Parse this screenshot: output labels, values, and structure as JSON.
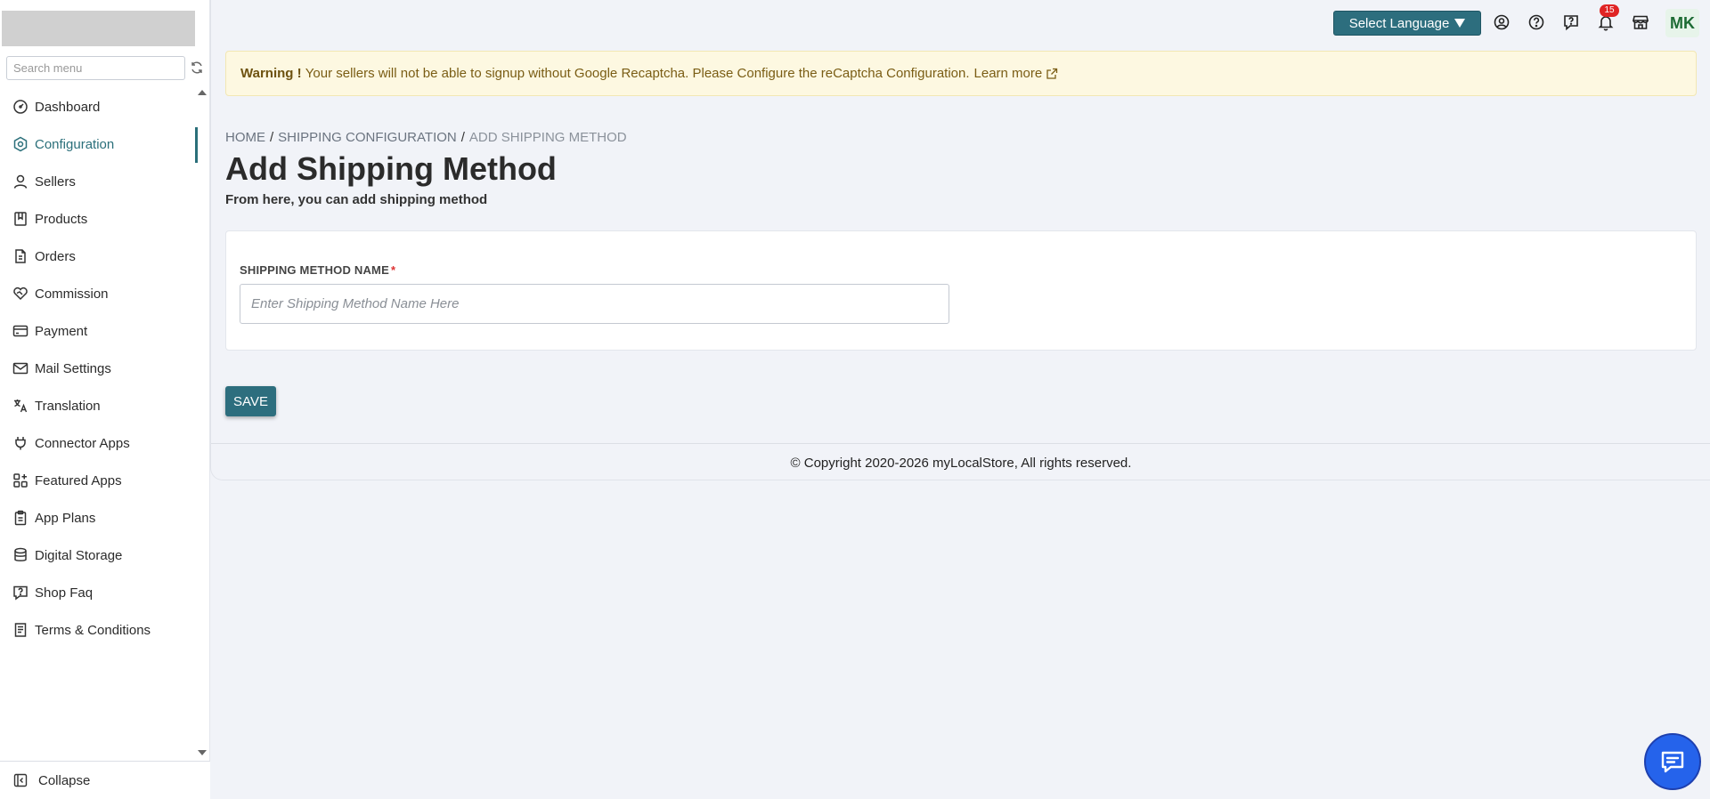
{
  "sidebar": {
    "search_placeholder": "Search menu",
    "items": [
      {
        "label": "Dashboard",
        "icon": "dashboard-gauge-icon"
      },
      {
        "label": "Configuration",
        "icon": "hexagon-settings-icon",
        "active": true
      },
      {
        "label": "Sellers",
        "icon": "user-icon"
      },
      {
        "label": "Products",
        "icon": "book-icon"
      },
      {
        "label": "Orders",
        "icon": "document-icon"
      },
      {
        "label": "Commission",
        "icon": "handshake-heart-icon"
      },
      {
        "label": "Payment",
        "icon": "credit-card-icon"
      },
      {
        "label": "Mail Settings",
        "icon": "mail-icon"
      },
      {
        "label": "Translation",
        "icon": "translate-icon"
      },
      {
        "label": "Connector Apps",
        "icon": "plug-icon"
      },
      {
        "label": "Featured Apps",
        "icon": "apps-grid-icon"
      },
      {
        "label": "App Plans",
        "icon": "clipboard-icon"
      },
      {
        "label": "Digital Storage",
        "icon": "database-icon"
      },
      {
        "label": "Shop Faq",
        "icon": "question-message-icon"
      },
      {
        "label": "Terms & Conditions",
        "icon": "file-text-icon"
      }
    ],
    "collapse_label": "Collapse"
  },
  "topbar": {
    "language_label": "Select Language",
    "notification_count": "15",
    "avatar_initials": "MK"
  },
  "warning": {
    "strong": "Warning !",
    "text": "Your sellers will not be able to signup without Google Recaptcha. Please Configure the reCaptcha Configuration.",
    "link": "Learn more"
  },
  "breadcrumb": {
    "home": "HOME",
    "parent": "SHIPPING CONFIGURATION",
    "current": "ADD SHIPPING METHOD",
    "separator": "/"
  },
  "page": {
    "title": "Add Shipping Method",
    "subtitle": "From here, you can add shipping method"
  },
  "form": {
    "field_label": "SHIPPING METHOD NAME",
    "required_mark": "*",
    "field_placeholder": "Enter Shipping Method Name Here",
    "field_value": "",
    "save_label": "SAVE"
  },
  "footer": {
    "copyright": "© Copyright 2020-2026 myLocalStore, All rights reserved."
  },
  "colors": {
    "accent": "#2d6e7e",
    "warning_bg": "#fdf8e1",
    "badge": "#e02424",
    "chat": "#2563eb"
  }
}
